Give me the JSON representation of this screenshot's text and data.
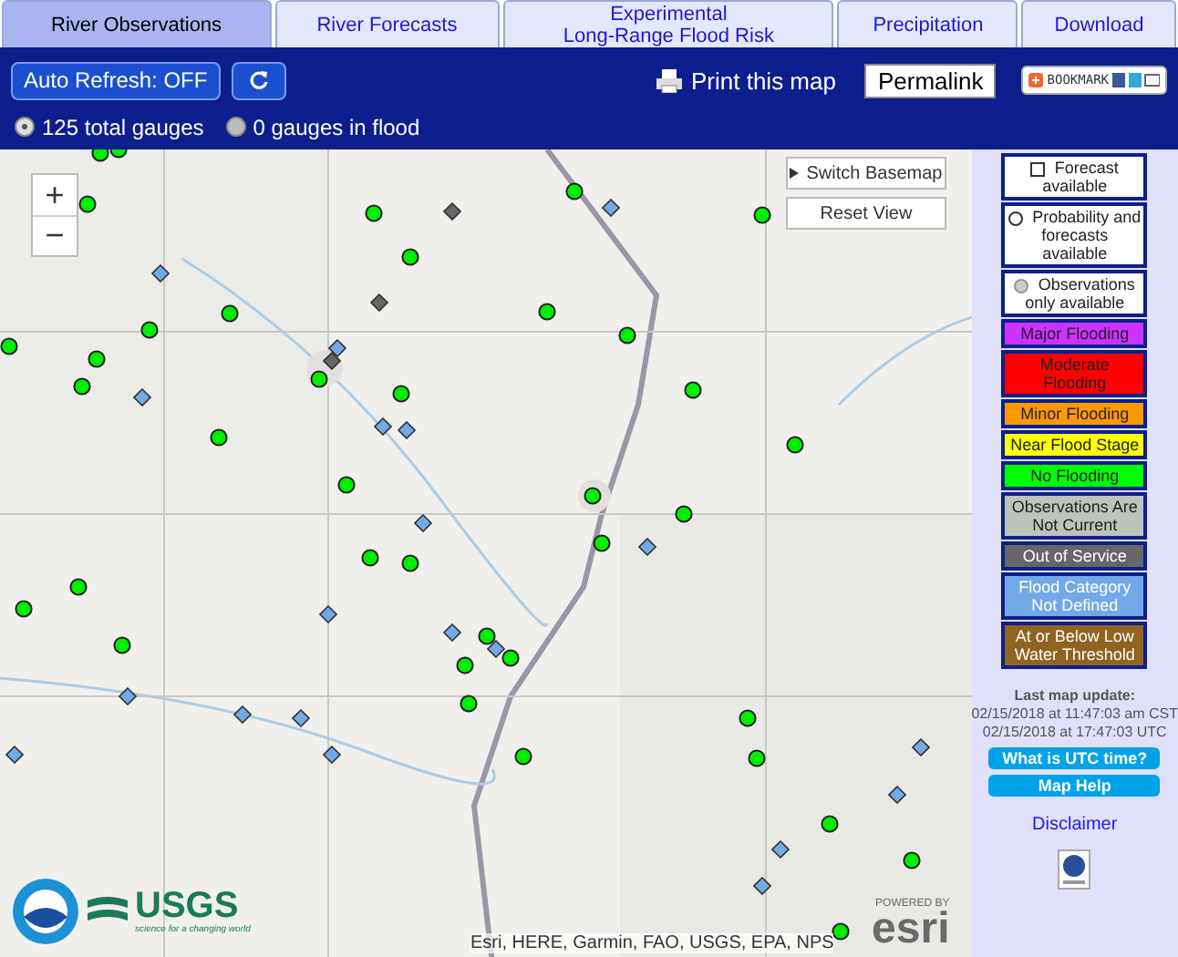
{
  "tabs": [
    {
      "label": "River Observations",
      "selected": true
    },
    {
      "label": "River Forecasts",
      "selected": false
    },
    {
      "label": "Experimental\nLong-Range Flood Risk",
      "selected": false
    },
    {
      "label": "Precipitation",
      "selected": false
    },
    {
      "label": "Download",
      "selected": false
    }
  ],
  "toolbar": {
    "auto_refresh": "Auto Refresh: OFF",
    "print": "Print this map",
    "permalink": "Permalink",
    "bookmark": "BOOKMARK"
  },
  "filters": [
    {
      "label": "125 total gauges",
      "selected": true
    },
    {
      "label": "0 gauges in flood",
      "selected": false
    }
  ],
  "map": {
    "zoom_in": "+",
    "zoom_out": "−",
    "switch_basemap": "Switch Basemap",
    "reset_view": "Reset View",
    "attribution": "Esri, HERE, Garmin, FAO, USGS, EPA, NPS",
    "usgs": "USGS",
    "usgs_tagline": "science for a changing world",
    "esri": "esri",
    "powered_by": "POWERED BY",
    "gauges": [
      {
        "kind": "no-flooding"
      },
      {
        "kind": "no-flooding"
      },
      {
        "kind": "no-flooding"
      },
      {
        "kind": "no-flooding"
      },
      {
        "kind": "no-flooding"
      },
      {
        "kind": "no-flooding"
      },
      {
        "kind": "no-flooding"
      },
      {
        "kind": "no-flooding"
      },
      {
        "kind": "no-flooding"
      },
      {
        "kind": "no-flooding"
      },
      {
        "kind": "no-flooding"
      },
      {
        "kind": "no-flooding"
      },
      {
        "kind": "no-flooding"
      },
      {
        "kind": "no-flooding"
      },
      {
        "kind": "no-flooding"
      },
      {
        "kind": "no-flooding"
      },
      {
        "kind": "no-flooding"
      },
      {
        "kind": "no-flooding"
      },
      {
        "kind": "no-flooding"
      },
      {
        "kind": "no-flooding"
      },
      {
        "kind": "no-flooding"
      },
      {
        "kind": "no-flooding"
      },
      {
        "kind": "no-flooding"
      },
      {
        "kind": "no-flooding"
      },
      {
        "kind": "no-flooding"
      },
      {
        "kind": "no-flooding"
      },
      {
        "kind": "no-flooding"
      },
      {
        "kind": "no-flooding"
      },
      {
        "kind": "no-flooding"
      },
      {
        "kind": "no-flooding"
      },
      {
        "kind": "no-flooding"
      },
      {
        "kind": "no-flooding"
      },
      {
        "kind": "no-flooding"
      },
      {
        "kind": "no-flooding"
      },
      {
        "kind": "no-flooding"
      },
      {
        "kind": "no-flooding"
      },
      {
        "kind": "no-flooding"
      },
      {
        "kind": "no-flooding"
      },
      {
        "kind": "not-defined"
      },
      {
        "kind": "not-defined"
      },
      {
        "kind": "not-defined"
      },
      {
        "kind": "not-defined"
      },
      {
        "kind": "not-defined"
      },
      {
        "kind": "not-defined"
      },
      {
        "kind": "not-defined"
      },
      {
        "kind": "not-defined"
      },
      {
        "kind": "not-defined"
      },
      {
        "kind": "not-defined"
      },
      {
        "kind": "not-defined"
      },
      {
        "kind": "not-defined"
      },
      {
        "kind": "not-defined"
      },
      {
        "kind": "not-defined"
      },
      {
        "kind": "not-defined"
      },
      {
        "kind": "not-defined"
      },
      {
        "kind": "not-defined"
      },
      {
        "kind": "not-defined"
      },
      {
        "kind": "not-defined"
      },
      {
        "kind": "not-defined"
      },
      {
        "kind": "out-of-service"
      },
      {
        "kind": "out-of-service"
      },
      {
        "kind": "out-of-service"
      }
    ]
  },
  "legend": {
    "items": [
      {
        "kind": "square",
        "label": "Forecast available"
      },
      {
        "kind": "circle",
        "label": "Probability and forecasts available"
      },
      {
        "kind": "dot",
        "label": "Observations only available"
      },
      {
        "kind": "category",
        "label": "Major Flooding",
        "color": "#cc33ff"
      },
      {
        "kind": "category",
        "label": "Moderate Flooding",
        "color": "#ff0000"
      },
      {
        "kind": "category",
        "label": "Minor Flooding",
        "color": "#ff9900"
      },
      {
        "kind": "category",
        "label": "Near Flood Stage",
        "color": "#ffff00"
      },
      {
        "kind": "category",
        "label": "No Flooding",
        "color": "#00ff00"
      },
      {
        "kind": "category",
        "label": "Observations Are Not Current",
        "color": "#bdc2bb"
      },
      {
        "kind": "category",
        "label": "Out of Service",
        "color": "#666666"
      },
      {
        "kind": "category",
        "label": "Flood Category Not Defined",
        "color": "#72a9e8"
      },
      {
        "kind": "category",
        "label": "At or Below Low Water Threshold",
        "color": "#906320"
      }
    ],
    "update_title": "Last map update:",
    "update_local": "02/15/2018 at 11:47:03 am CST",
    "update_utc": "02/15/2018 at 17:47:03 UTC",
    "buttons": [
      "What is UTC time?",
      "Map Help"
    ],
    "disclaimer": "Disclaimer"
  }
}
